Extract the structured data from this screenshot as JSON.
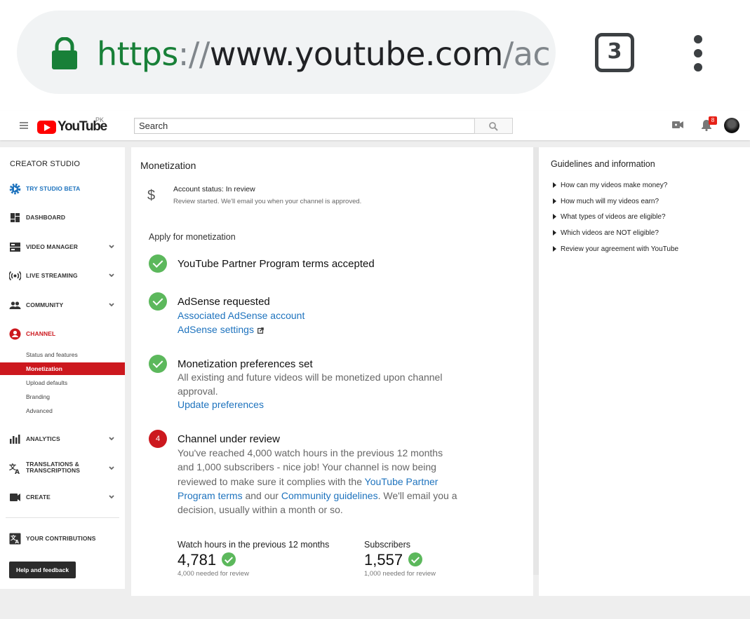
{
  "browser": {
    "url_scheme": "https",
    "url_separator": "://",
    "url_host": "www.youtube.com",
    "url_rest": "/ac",
    "tab_count": "3"
  },
  "masthead": {
    "logo_text": "YouTube",
    "region": "PK",
    "search_placeholder": "Search",
    "notification_count": "8"
  },
  "sidebar": {
    "title": "CREATOR STUDIO",
    "try_beta": "TRY STUDIO BETA",
    "dashboard": "DASHBOARD",
    "video_manager": "VIDEO MANAGER",
    "live_streaming": "LIVE STREAMING",
    "community": "COMMUNITY",
    "channel": "CHANNEL",
    "channel_sub": [
      "Status and features",
      "Monetization",
      "Upload defaults",
      "Branding",
      "Advanced"
    ],
    "analytics": "ANALYTICS",
    "translations_line1": "TRANSLATIONS &",
    "translations_line2": "TRANSCRIPTIONS",
    "create": "CREATE",
    "contributions": "YOUR CONTRIBUTIONS",
    "help": "Help and feedback"
  },
  "main": {
    "title": "Monetization",
    "account_status": "Account status: In review",
    "account_sub": "Review started. We'll email you when your channel is approved.",
    "apply_title": "Apply for monetization",
    "step1_title": "YouTube Partner Program terms accepted",
    "step2_title": "AdSense requested",
    "step2_link1": "Associated AdSense account",
    "step2_link2": "AdSense settings",
    "step3_title": "Monetization preferences set",
    "step3_text": "All existing and future videos will be monetized upon channel approval.",
    "step3_link": "Update preferences",
    "step4_number": "4",
    "step4_title": "Channel under review",
    "step4_text_a": "You've reached 4,000 watch hours in the previous 12 months and 1,000 subscribers - nice job! Your channel is now being reviewed to make sure it complies with the ",
    "step4_link_a": "YouTube Partner Program terms",
    "step4_text_b": " and our ",
    "step4_link_b": "Community guidelines",
    "step4_text_c": ". We'll email you a decision, usually within a month or so.",
    "watch_label": "Watch hours in the previous 12 months",
    "watch_value": "4,781",
    "watch_need": "4,000 needed for review",
    "subs_label": "Subscribers",
    "subs_value": "1,557",
    "subs_need": "1,000 needed for review"
  },
  "guide": {
    "title": "Guidelines and information",
    "items": [
      "How can my videos make money?",
      "How much will my videos earn?",
      "What types of videos are eligible?",
      "Which videos are NOT eligible?",
      "Review your agreement with YouTube"
    ]
  },
  "colors": {
    "youtube_red": "#cc181e",
    "link_blue": "#1e73be",
    "check_green": "#5cb85c",
    "url_green": "#188038"
  }
}
